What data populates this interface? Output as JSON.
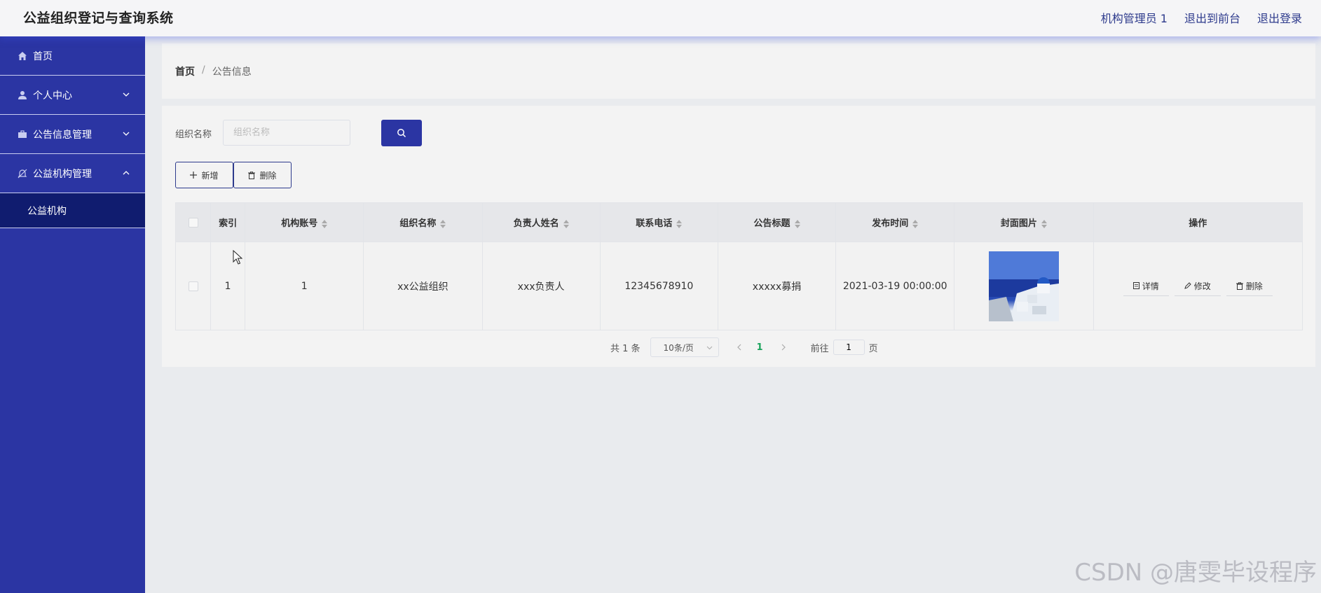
{
  "app": {
    "title": "公益组织登记与查询系统"
  },
  "header": {
    "user": "机构管理员 1",
    "to_front": "退出到前台",
    "logout": "退出登录"
  },
  "sidebar": {
    "items": [
      {
        "label": "首页",
        "icon": "home-icon"
      },
      {
        "label": "个人中心",
        "icon": "user-icon"
      },
      {
        "label": "公告信息管理",
        "icon": "briefcase-icon"
      },
      {
        "label": "公益机构管理",
        "icon": "bell-off-icon"
      }
    ],
    "active_sub": "公益机构"
  },
  "breadcrumb": {
    "home": "首页",
    "sep": "/",
    "current": "公告信息"
  },
  "search": {
    "label": "组织名称",
    "placeholder": "组织名称"
  },
  "toolbar": {
    "add_label": "新增",
    "delete_label": "删除"
  },
  "table": {
    "headers": [
      "索引",
      "机构账号",
      "组织名称",
      "负责人姓名",
      "联系电话",
      "公告标题",
      "发布时间",
      "封面图片",
      "操作"
    ],
    "rows": [
      {
        "index": "1",
        "account": "1",
        "org_name": "xx公益组织",
        "leader": "xxx负责人",
        "phone": "12345678910",
        "title": "xxxxx募捐",
        "time": "2021-03-19 00:00:00"
      }
    ],
    "ops": {
      "detail": "详情",
      "edit": "修改",
      "delete": "删除"
    }
  },
  "pagination": {
    "total": "共 1 条",
    "page_size": "10条/页",
    "current_page": "1",
    "goto_label": "前往",
    "goto_value": "1",
    "suffix": "页"
  },
  "watermark": "CSDN @唐雯毕设程序",
  "colors": {
    "sidebar": "#2b35a3",
    "sidebar_active": "#101c6f",
    "accent": "#2b35a3",
    "page_active": "#1aa35c"
  }
}
